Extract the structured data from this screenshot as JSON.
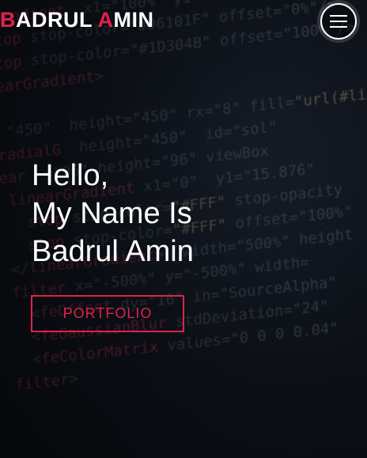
{
  "header": {
    "brand_initial_1": "B",
    "brand_rest_1": "ADRUL ",
    "brand_initial_2": "A",
    "brand_rest_2": "MIN",
    "menu_icon": "hamburger-icon"
  },
  "hero": {
    "line_1": "Hello,",
    "line_2": "My Name Is",
    "line_3": "Badrul Amin",
    "button_label": "PORTFOLIO"
  },
  "colors": {
    "accent": "#e0224b",
    "text": "#ffffff",
    "background": "#0b0d12"
  }
}
